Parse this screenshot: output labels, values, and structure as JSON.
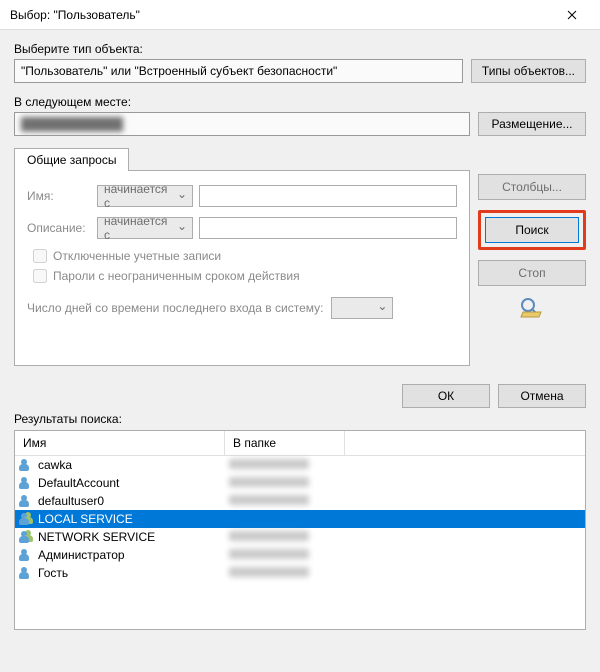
{
  "title": "Выбор: \"Пользователь\"",
  "labels": {
    "object_type": "Выберите тип объекта:",
    "object_value": "\"Пользователь\" или \"Встроенный субъект безопасности\"",
    "location_label": "В следующем месте:",
    "location_value": "████████████",
    "btn_object_types": "Типы объектов...",
    "btn_locations": "Размещение...",
    "tab_common": "Общие запросы",
    "form_name": "Имя:",
    "form_desc": "Описание:",
    "combo_starts": "начинается с",
    "check_disabled": "Отключенные учетные записи",
    "check_nonexpire": "Пароли с неограниченным сроком действия",
    "days_label": "Число дней со времени последнего входа в систему:",
    "btn_columns": "Столбцы...",
    "btn_search": "Поиск",
    "btn_stop": "Стоп",
    "btn_ok": "ОК",
    "btn_cancel": "Отмена",
    "results": "Результаты поиска:",
    "col_name": "Имя",
    "col_folder": "В папке"
  },
  "results": [
    {
      "name": "cawka",
      "type": "user",
      "selected": false
    },
    {
      "name": "DefaultAccount",
      "type": "user",
      "selected": false
    },
    {
      "name": "defaultuser0",
      "type": "user",
      "selected": false
    },
    {
      "name": "LOCAL SERVICE",
      "type": "group",
      "selected": true
    },
    {
      "name": "NETWORK SERVICE",
      "type": "group",
      "selected": false
    },
    {
      "name": "Администратор",
      "type": "user",
      "selected": false
    },
    {
      "name": "Гость",
      "type": "user",
      "selected": false
    }
  ]
}
